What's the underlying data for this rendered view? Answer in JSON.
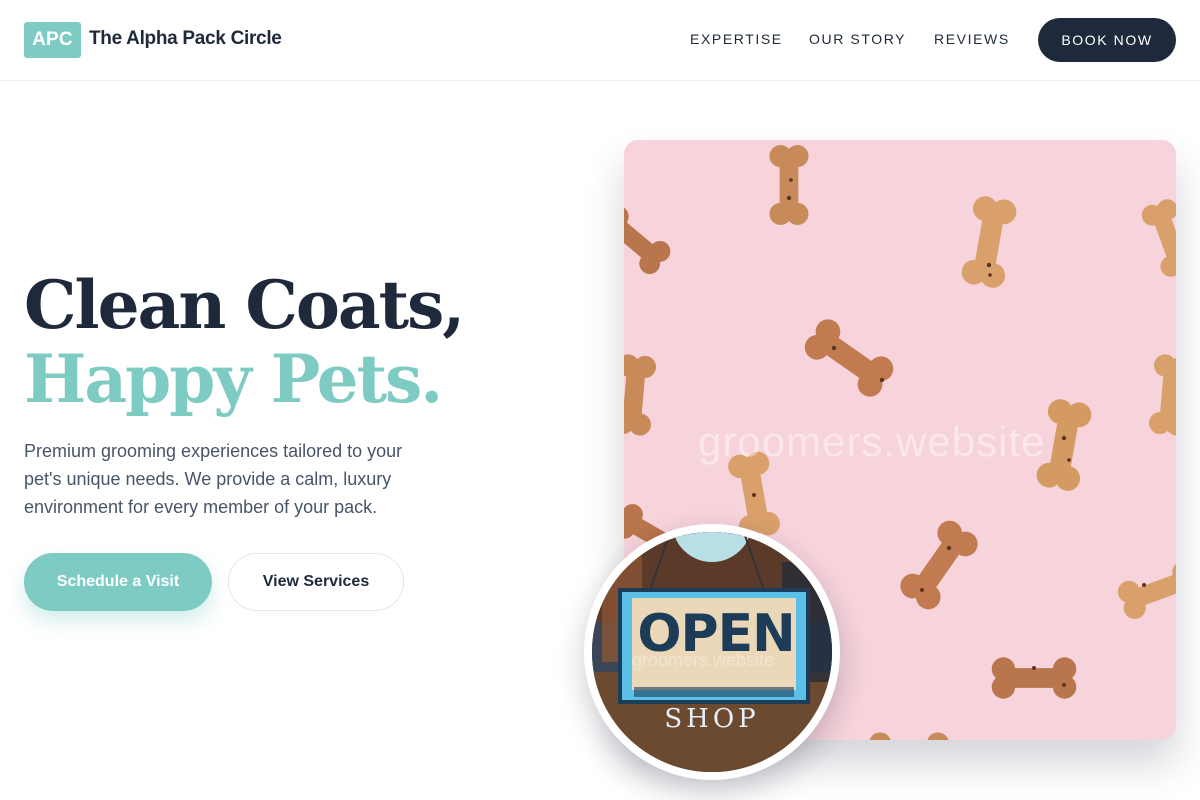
{
  "brand": {
    "badge": "APC",
    "name": "The Alpha Pack Circle"
  },
  "nav": {
    "links": [
      "EXPERTISE",
      "OUR STORY",
      "REVIEWS"
    ],
    "cta": "BOOK NOW"
  },
  "hero": {
    "title_line1": "Clean Coats,",
    "title_line2": "Happy Pets.",
    "description": "Premium grooming experiences tailored to your pet's unique needs. We provide a calm, luxury environment for every member of your pack.",
    "primary_button": "Schedule a Visit",
    "secondary_button": "View Services"
  },
  "image": {
    "watermark": "groomers.website"
  },
  "badge_image": {
    "sign_word": "OPEN",
    "sign_sub": "SHOP",
    "watermark": "groomers.website"
  },
  "colors": {
    "accent": "#7ecbc3",
    "dark": "#1e293b",
    "card_bg": "#f7d3dc"
  }
}
